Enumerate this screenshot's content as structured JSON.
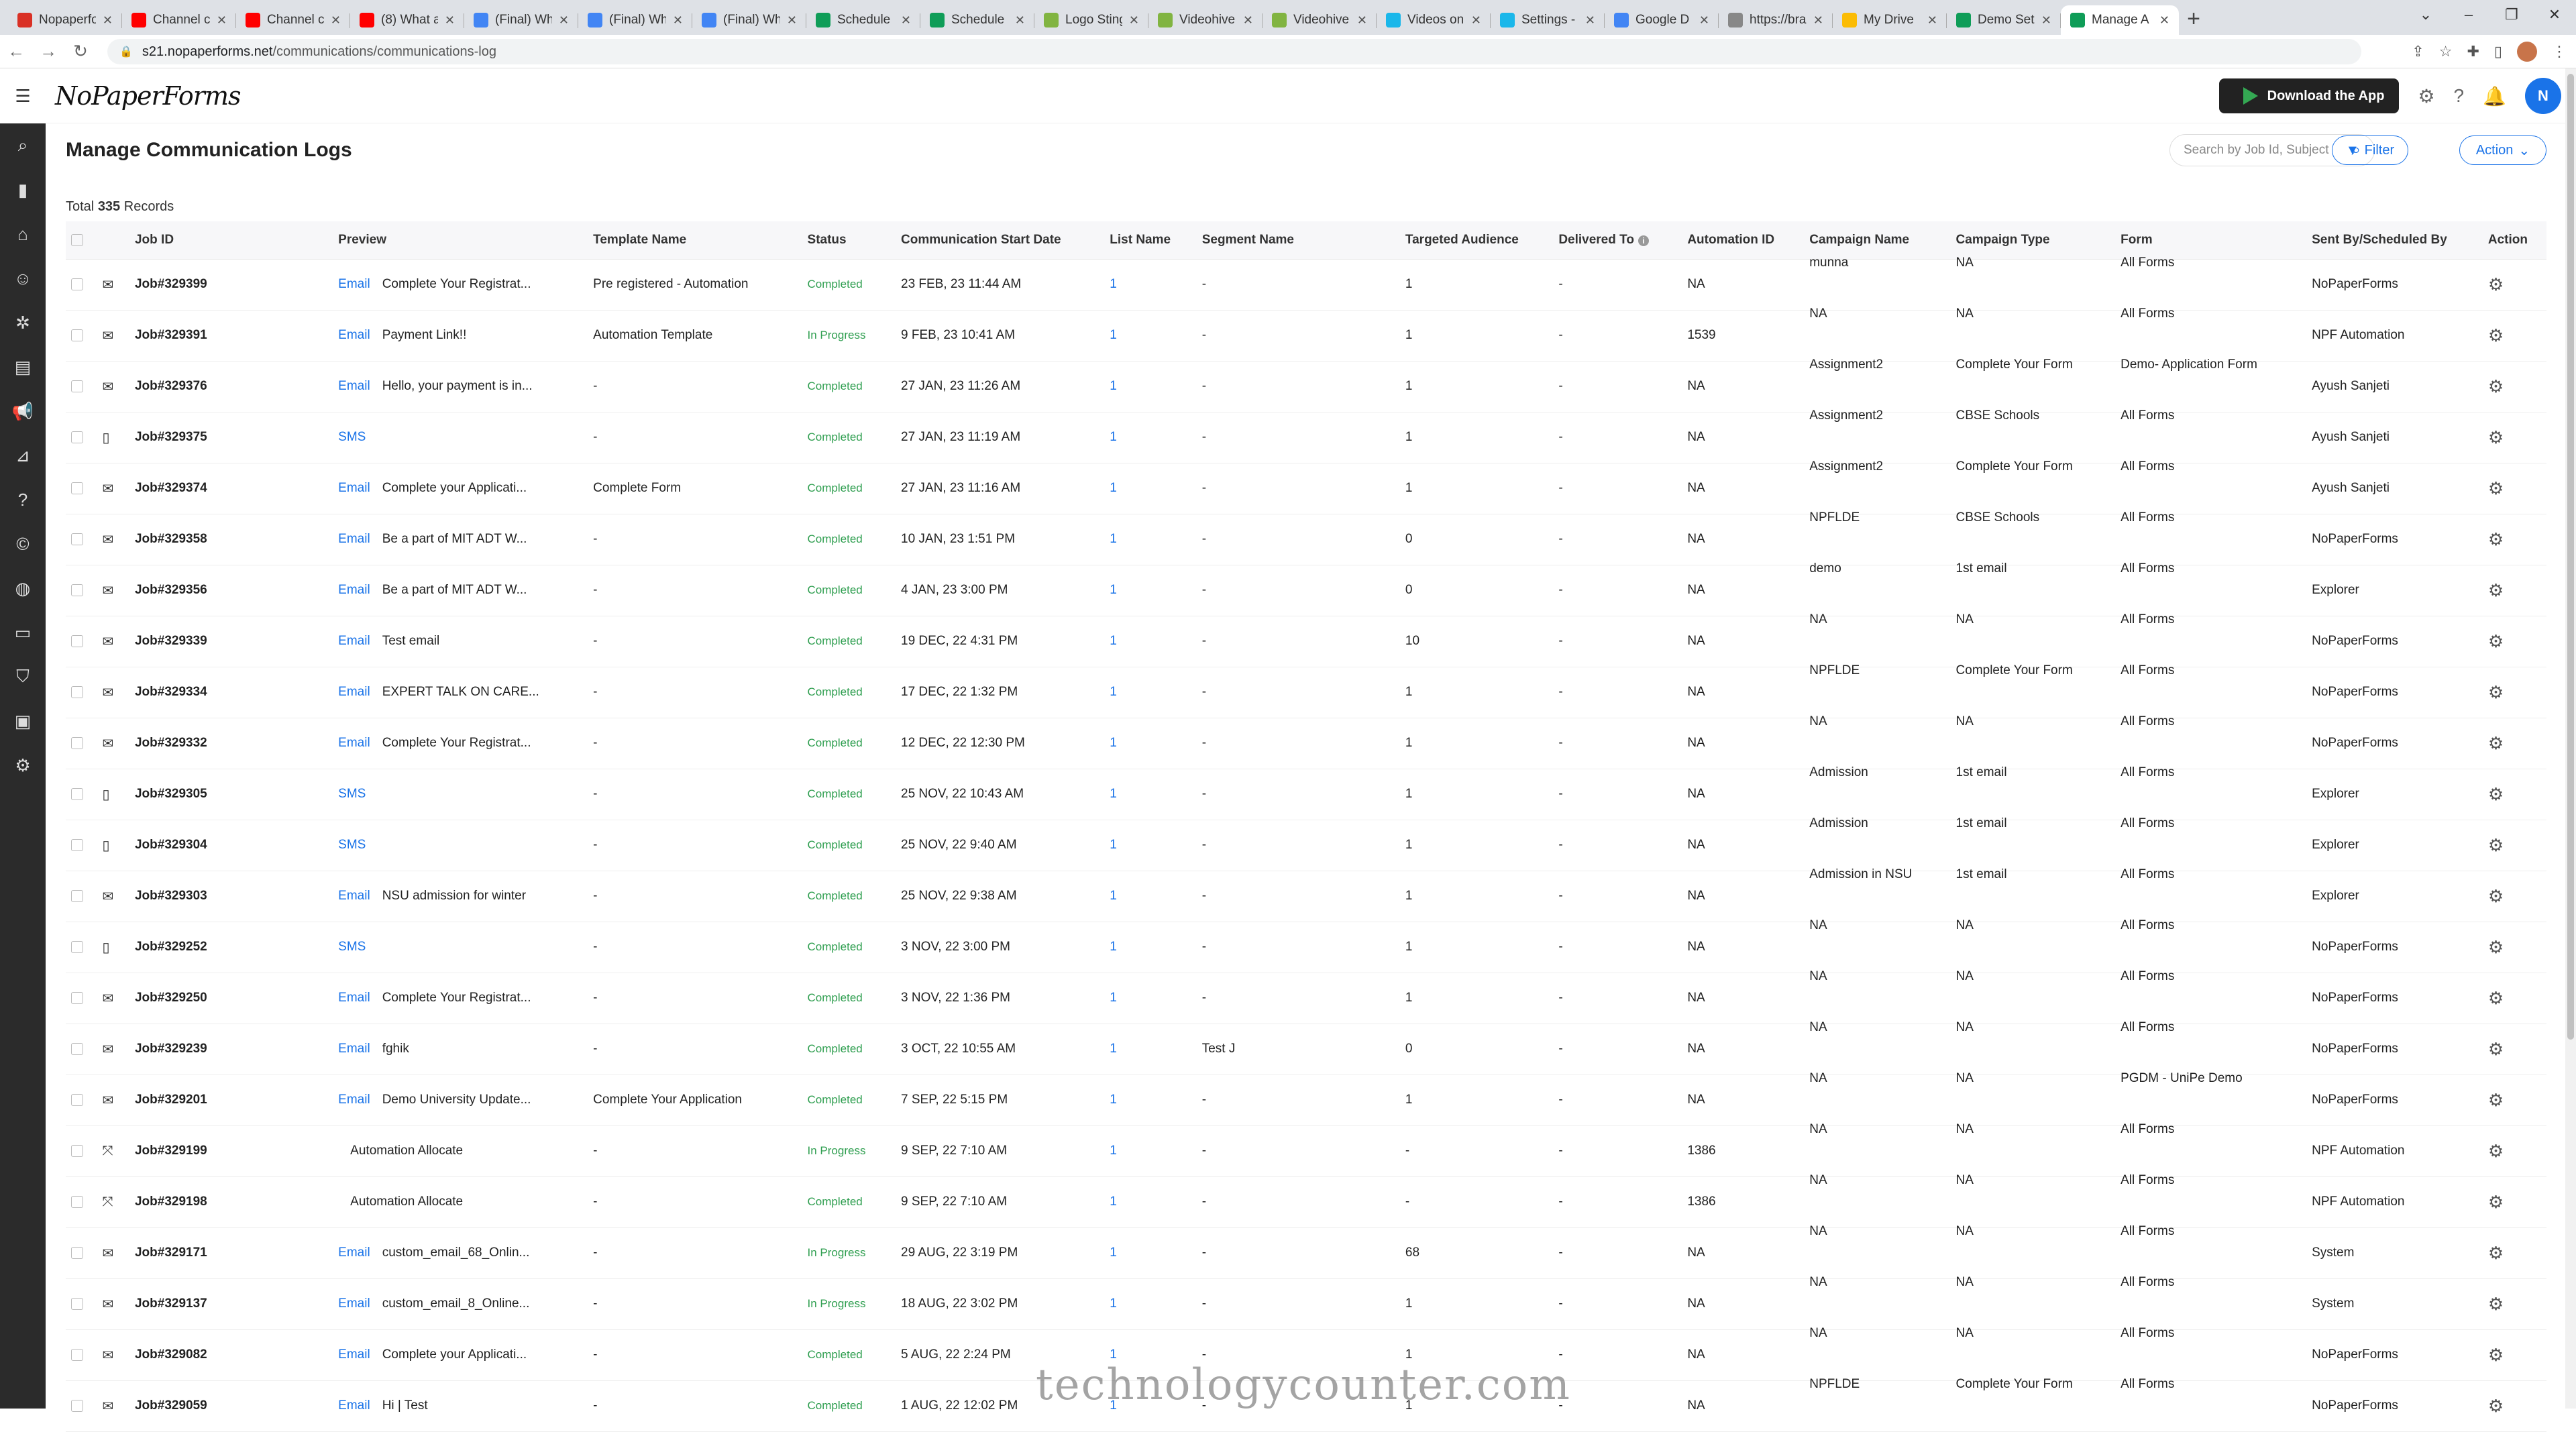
{
  "browser": {
    "tabs": [
      "Nopaperfo",
      "Channel c",
      "Channel c",
      "(8) What a",
      "(Final) Wh",
      "(Final) Wh",
      "(Final) Wh",
      "Schedule",
      "Schedule",
      "Logo Sting",
      "Videohive",
      "Videohive",
      "Videos on",
      "Settings -",
      "Google D",
      "https://bra",
      "My Drive",
      "Demo Set",
      "Manage A"
    ],
    "tab_colors": [
      "#d93025",
      "#ff0000",
      "#ff0000",
      "#ff0000",
      "#4285f4",
      "#4285f4",
      "#4285f4",
      "#0f9d58",
      "#0f9d58",
      "#81b441",
      "#81b441",
      "#81b441",
      "#1ab7ea",
      "#1ab7ea",
      "#4285f4",
      "#888888",
      "#fbbc04",
      "#0f9d58",
      "#0f9d58"
    ],
    "url_host": "s21.nopaperforms.net",
    "url_path": "/communications/communications-log"
  },
  "app": {
    "logo": "NoPaperForms",
    "download_btn": "Download the App",
    "user_initial": "N"
  },
  "page": {
    "title": "Manage Communication Logs",
    "search_placeholder": "Search by Job Id, Subject",
    "filter_label": "Filter",
    "action_label": "Action",
    "total_prefix": "Total",
    "total_count": "335",
    "total_suffix": "Records"
  },
  "table": {
    "columns": [
      "Job ID",
      "Preview",
      "Template Name",
      "Status",
      "Communication Start Date",
      "List Name",
      "Segment Name",
      "Targeted Audience",
      "Delivered To",
      "Automation ID",
      "Campaign Name",
      "Campaign Type",
      "Form",
      "Sent By/Scheduled By",
      "Action"
    ],
    "rows": [
      {
        "icon": "mail",
        "job": "Job#329399",
        "ch": "Email",
        "pv": "Complete Your Registrat...",
        "tpl": "Pre registered - Automation",
        "st": "Completed",
        "date": "23 FEB, 23 11:44 AM",
        "list": "1",
        "seg": "-",
        "aud": "1",
        "del": "-",
        "auto": "NA",
        "camp": "munna",
        "ctype": "NA",
        "form": "All Forms",
        "by": "NoPaperForms"
      },
      {
        "icon": "mail",
        "job": "Job#329391",
        "ch": "Email",
        "pv": "Payment Link!!",
        "tpl": "Automation Template",
        "st": "In Progress",
        "date": "9 FEB, 23 10:41 AM",
        "list": "1",
        "seg": "-",
        "aud": "1",
        "del": "-",
        "auto": "1539",
        "camp": "NA",
        "ctype": "NA",
        "form": "All Forms",
        "by": "NPF Automation"
      },
      {
        "icon": "mail",
        "job": "Job#329376",
        "ch": "Email",
        "pv": "Hello, your payment is in...",
        "tpl": "-",
        "st": "Completed",
        "date": "27 JAN, 23 11:26 AM",
        "list": "1",
        "seg": "-",
        "aud": "1",
        "del": "-",
        "auto": "NA",
        "camp": "Assignment2",
        "ctype": "Complete Your Form",
        "form": "Demo- Application Form",
        "by": "Ayush Sanjeti"
      },
      {
        "icon": "sms",
        "job": "Job#329375",
        "ch": "SMS",
        "pv": "",
        "tpl": "-",
        "st": "Completed",
        "date": "27 JAN, 23 11:19 AM",
        "list": "1",
        "seg": "-",
        "aud": "1",
        "del": "-",
        "auto": "NA",
        "camp": "Assignment2",
        "ctype": "CBSE Schools",
        "form": "All Forms",
        "by": "Ayush Sanjeti"
      },
      {
        "icon": "mail",
        "job": "Job#329374",
        "ch": "Email",
        "pv": "Complete your Applicati...",
        "tpl": "Complete Form",
        "st": "Completed",
        "date": "27 JAN, 23 11:16 AM",
        "list": "1",
        "seg": "-",
        "aud": "1",
        "del": "-",
        "auto": "NA",
        "camp": "Assignment2",
        "ctype": "Complete Your Form",
        "form": "All Forms",
        "by": "Ayush Sanjeti"
      },
      {
        "icon": "mail",
        "job": "Job#329358",
        "ch": "Email",
        "pv": "Be a part of MIT ADT W...",
        "tpl": "-",
        "st": "Completed",
        "date": "10 JAN, 23 1:51 PM",
        "list": "1",
        "seg": "-",
        "aud": "0",
        "del": "-",
        "auto": "NA",
        "camp": "NPFLDE",
        "ctype": "CBSE Schools",
        "form": "All Forms",
        "by": "NoPaperForms"
      },
      {
        "icon": "mail",
        "job": "Job#329356",
        "ch": "Email",
        "pv": "Be a part of MIT ADT W...",
        "tpl": "-",
        "st": "Completed",
        "date": "4 JAN, 23 3:00 PM",
        "list": "1",
        "seg": "-",
        "aud": "0",
        "del": "-",
        "auto": "NA",
        "camp": "demo",
        "ctype": "1st email",
        "form": "All Forms",
        "by": "Explorer"
      },
      {
        "icon": "mail",
        "job": "Job#329339",
        "ch": "Email",
        "pv": "Test email",
        "tpl": "-",
        "st": "Completed",
        "date": "19 DEC, 22 4:31 PM",
        "list": "1",
        "seg": "-",
        "aud": "10",
        "del": "-",
        "auto": "NA",
        "camp": "NA",
        "ctype": "NA",
        "form": "All Forms",
        "by": "NoPaperForms"
      },
      {
        "icon": "mail",
        "job": "Job#329334",
        "ch": "Email",
        "pv": "EXPERT TALK ON CARE...",
        "tpl": "-",
        "st": "Completed",
        "date": "17 DEC, 22 1:32 PM",
        "list": "1",
        "seg": "-",
        "aud": "1",
        "del": "-",
        "auto": "NA",
        "camp": "NPFLDE",
        "ctype": "Complete Your Form",
        "form": "All Forms",
        "by": "NoPaperForms"
      },
      {
        "icon": "mail",
        "job": "Job#329332",
        "ch": "Email",
        "pv": "Complete Your Registrat...",
        "tpl": "-",
        "st": "Completed",
        "date": "12 DEC, 22 12:30 PM",
        "list": "1",
        "seg": "-",
        "aud": "1",
        "del": "-",
        "auto": "NA",
        "camp": "NA",
        "ctype": "NA",
        "form": "All Forms",
        "by": "NoPaperForms"
      },
      {
        "icon": "sms",
        "job": "Job#329305",
        "ch": "SMS",
        "pv": "",
        "tpl": "-",
        "st": "Completed",
        "date": "25 NOV, 22 10:43 AM",
        "list": "1",
        "seg": "-",
        "aud": "1",
        "del": "-",
        "auto": "NA",
        "camp": "Admission",
        "ctype": "1st email",
        "form": "All Forms",
        "by": "Explorer"
      },
      {
        "icon": "sms",
        "job": "Job#329304",
        "ch": "SMS",
        "pv": "",
        "tpl": "-",
        "st": "Completed",
        "date": "25 NOV, 22 9:40 AM",
        "list": "1",
        "seg": "-",
        "aud": "1",
        "del": "-",
        "auto": "NA",
        "camp": "Admission",
        "ctype": "1st email",
        "form": "All Forms",
        "by": "Explorer"
      },
      {
        "icon": "mail",
        "job": "Job#329303",
        "ch": "Email",
        "pv": "NSU admission for winter",
        "tpl": "-",
        "st": "Completed",
        "date": "25 NOV, 22 9:38 AM",
        "list": "1",
        "seg": "-",
        "aud": "1",
        "del": "-",
        "auto": "NA",
        "camp": "Admission in NSU",
        "ctype": "1st email",
        "form": "All Forms",
        "by": "Explorer"
      },
      {
        "icon": "sms",
        "job": "Job#329252",
        "ch": "SMS",
        "pv": "",
        "tpl": "-",
        "st": "Completed",
        "date": "3 NOV, 22 3:00 PM",
        "list": "1",
        "seg": "-",
        "aud": "1",
        "del": "-",
        "auto": "NA",
        "camp": "NA",
        "ctype": "NA",
        "form": "All Forms",
        "by": "NoPaperForms"
      },
      {
        "icon": "mail",
        "job": "Job#329250",
        "ch": "Email",
        "pv": "Complete Your Registrat...",
        "tpl": "-",
        "st": "Completed",
        "date": "3 NOV, 22 1:36 PM",
        "list": "1",
        "seg": "-",
        "aud": "1",
        "del": "-",
        "auto": "NA",
        "camp": "NA",
        "ctype": "NA",
        "form": "All Forms",
        "by": "NoPaperForms"
      },
      {
        "icon": "mail",
        "job": "Job#329239",
        "ch": "Email",
        "pv": "fghik",
        "tpl": "-",
        "st": "Completed",
        "date": "3 OCT, 22 10:55 AM",
        "list": "1",
        "seg": "Test J",
        "aud": "0",
        "del": "-",
        "auto": "NA",
        "camp": "NA",
        "ctype": "NA",
        "form": "All Forms",
        "by": "NoPaperForms"
      },
      {
        "icon": "mail",
        "job": "Job#329201",
        "ch": "Email",
        "pv": "Demo University Update...",
        "tpl": "Complete Your Application",
        "st": "Completed",
        "date": "7 SEP, 22 5:15 PM",
        "list": "1",
        "seg": "-",
        "aud": "1",
        "del": "-",
        "auto": "NA",
        "camp": "NA",
        "ctype": "NA",
        "form": "PGDM - UniPe Demo",
        "by": "NoPaperForms"
      },
      {
        "icon": "auto",
        "job": "Job#329199",
        "ch": "",
        "pv": "Automation Allocate",
        "tpl": "-",
        "st": "In Progress",
        "date": "9 SEP, 22 7:10 AM",
        "list": "1",
        "seg": "-",
        "aud": "-",
        "del": "-",
        "auto": "1386",
        "camp": "NA",
        "ctype": "NA",
        "form": "All Forms",
        "by": "NPF Automation"
      },
      {
        "icon": "auto",
        "job": "Job#329198",
        "ch": "",
        "pv": "Automation Allocate",
        "tpl": "-",
        "st": "Completed",
        "date": "9 SEP, 22 7:10 AM",
        "list": "1",
        "seg": "-",
        "aud": "-",
        "del": "-",
        "auto": "1386",
        "camp": "NA",
        "ctype": "NA",
        "form": "All Forms",
        "by": "NPF Automation"
      },
      {
        "icon": "mail",
        "job": "Job#329171",
        "ch": "Email",
        "pv": "custom_email_68_Onlin...",
        "tpl": "-",
        "st": "In Progress",
        "date": "29 AUG, 22 3:19 PM",
        "list": "1",
        "seg": "-",
        "aud": "68",
        "del": "-",
        "auto": "NA",
        "camp": "NA",
        "ctype": "NA",
        "form": "All Forms",
        "by": "System"
      },
      {
        "icon": "mail",
        "job": "Job#329137",
        "ch": "Email",
        "pv": "custom_email_8_Online...",
        "tpl": "-",
        "st": "In Progress",
        "date": "18 AUG, 22 3:02 PM",
        "list": "1",
        "seg": "-",
        "aud": "1",
        "del": "-",
        "auto": "NA",
        "camp": "NA",
        "ctype": "NA",
        "form": "All Forms",
        "by": "System"
      },
      {
        "icon": "mail",
        "job": "Job#329082",
        "ch": "Email",
        "pv": "Complete your Applicati...",
        "tpl": "-",
        "st": "Completed",
        "date": "5 AUG, 22 2:24 PM",
        "list": "1",
        "seg": "-",
        "aud": "1",
        "del": "-",
        "auto": "NA",
        "camp": "NA",
        "ctype": "NA",
        "form": "All Forms",
        "by": "NoPaperForms"
      },
      {
        "icon": "mail",
        "job": "Job#329059",
        "ch": "Email",
        "pv": "Hi | Test",
        "tpl": "-",
        "st": "Completed",
        "date": "1 AUG, 22 12:02 PM",
        "list": "1",
        "seg": "-",
        "aud": "1",
        "del": "-",
        "auto": "NA",
        "camp": "NPFLDE",
        "ctype": "Complete Your Form",
        "form": "All Forms",
        "by": "NoPaperForms"
      }
    ]
  },
  "watermark": "technologycounter.com"
}
